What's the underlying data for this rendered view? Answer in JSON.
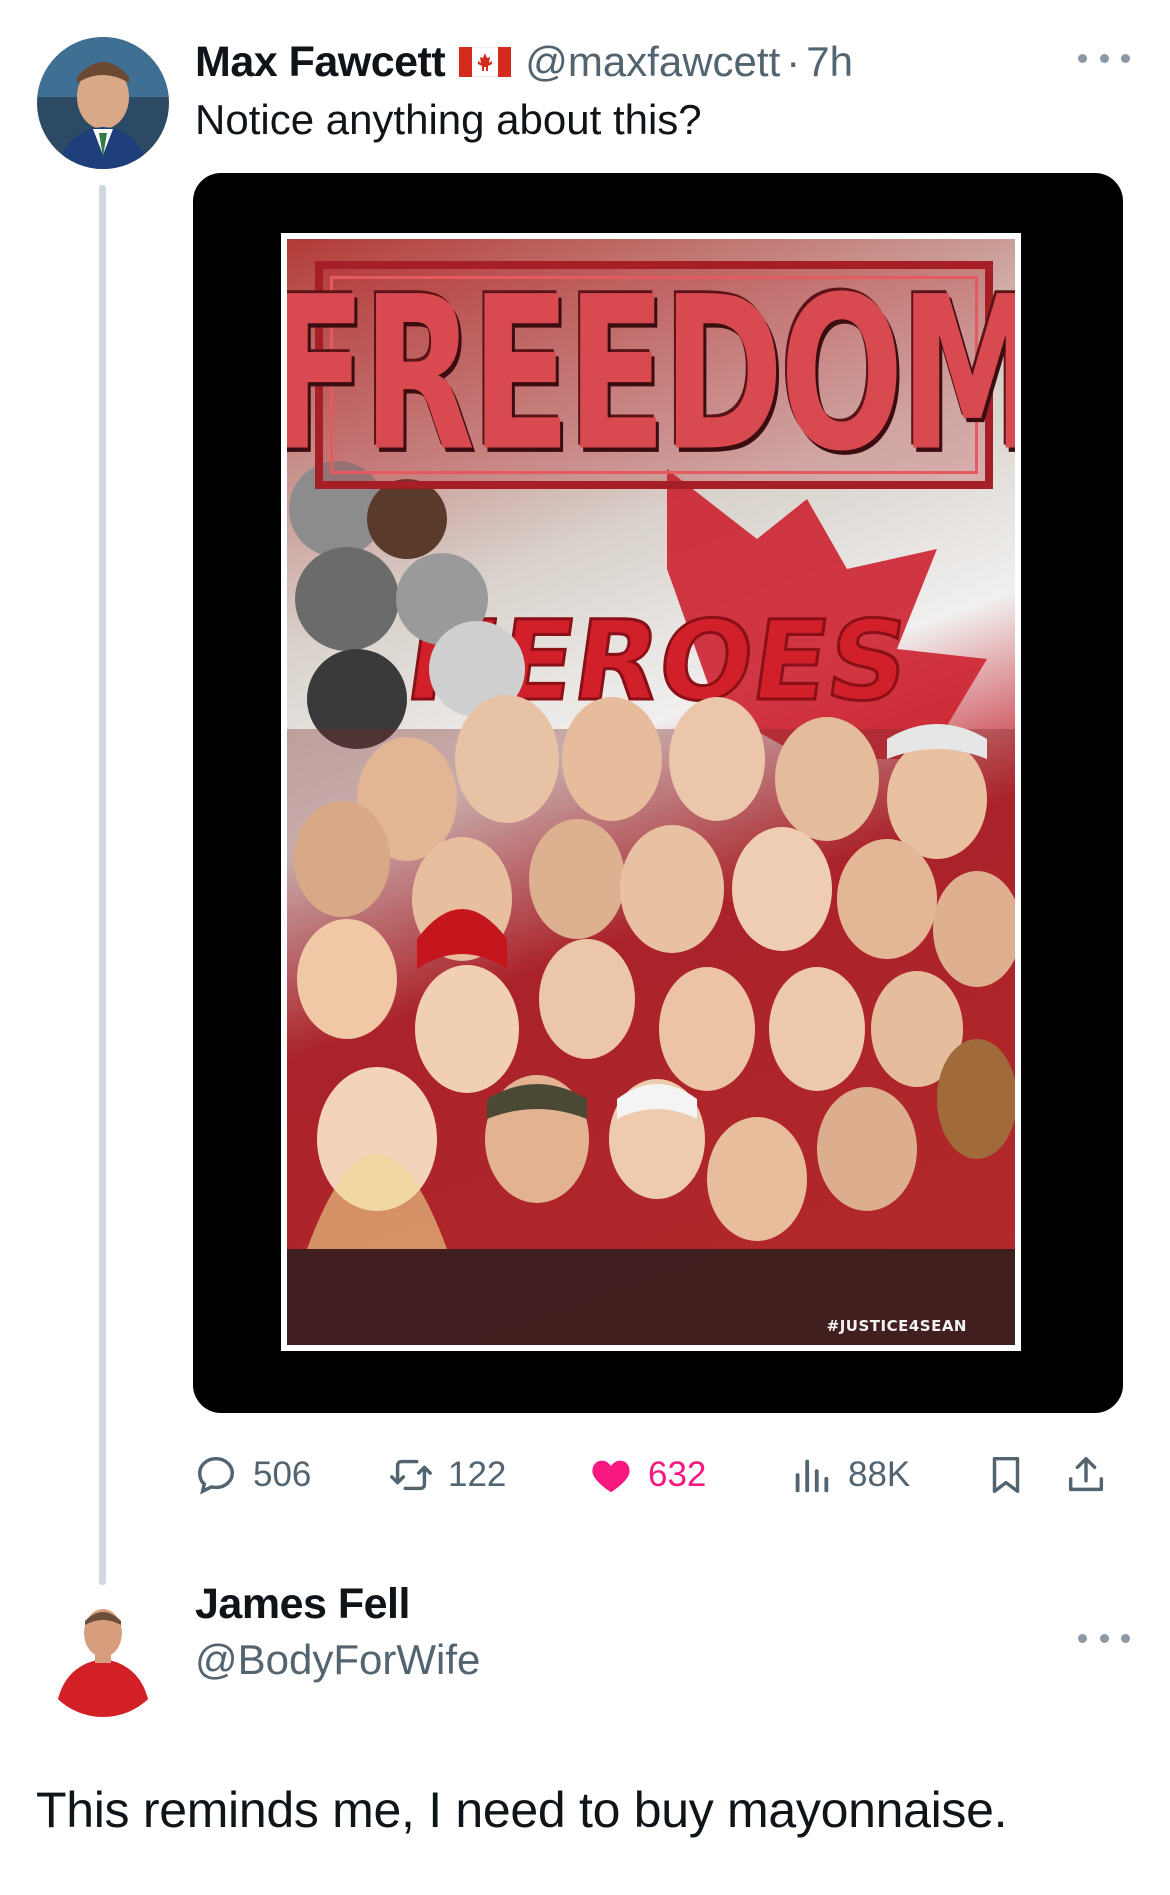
{
  "tweet1": {
    "author_name": "Max Fawcett",
    "flag_icon": "canada-flag-icon",
    "handle": "@maxfawcett",
    "separator": "·",
    "time": "7h",
    "text": "Notice anything about this?",
    "media": {
      "headline": "FREEDOM",
      "subheadline": "HEROES",
      "hashtag": "#JUSTICE4SEAN"
    },
    "actions": {
      "replies": "506",
      "retweets": "122",
      "likes": "632",
      "views": "88K"
    }
  },
  "tweet2": {
    "author_name": "James Fell",
    "handle": "@BodyForWife",
    "text": "This reminds me, I need to buy mayonnaise."
  },
  "colors": {
    "like_active": "#f91880",
    "secondary_text": "#536471",
    "thread_line": "#cfd9de"
  }
}
